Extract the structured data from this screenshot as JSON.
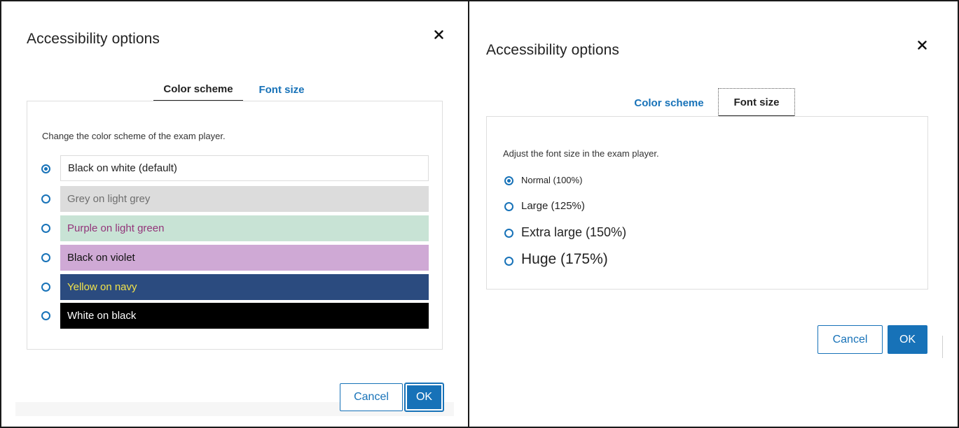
{
  "left_dialog": {
    "title": "Accessibility options",
    "tabs": [
      {
        "label": "Color scheme",
        "active": true
      },
      {
        "label": "Font size",
        "active": false
      }
    ],
    "description": "Change the color scheme of the exam player.",
    "options": [
      {
        "label": "Black on white (default)",
        "selected": true,
        "bg": "#ffffff",
        "fg": "#111111"
      },
      {
        "label": "Grey on light grey",
        "selected": false,
        "bg": "#dcdcdc",
        "fg": "#6e6e6e"
      },
      {
        "label": "Purple on light green",
        "selected": false,
        "bg": "#c8e3d5",
        "fg": "#93357a"
      },
      {
        "label": "Black on violet",
        "selected": false,
        "bg": "#cfa9d5",
        "fg": "#111111"
      },
      {
        "label": "Yellow on navy",
        "selected": false,
        "bg": "#2b4b7f",
        "fg": "#f2e34a"
      },
      {
        "label": "White on black",
        "selected": false,
        "bg": "#000000",
        "fg": "#ffffff"
      }
    ],
    "cancel_label": "Cancel",
    "ok_label": "OK"
  },
  "right_dialog": {
    "title": "Accessibility options",
    "tabs": [
      {
        "label": "Color scheme",
        "active": false
      },
      {
        "label": "Font size",
        "active": true
      }
    ],
    "description": "Adjust the font size in the exam player.",
    "options": [
      {
        "label": "Normal (100%)",
        "selected": true
      },
      {
        "label": "Large (125%)",
        "selected": false
      },
      {
        "label": "Extra large (150%)",
        "selected": false
      },
      {
        "label": "Huge (175%)",
        "selected": false
      }
    ],
    "cancel_label": "Cancel",
    "ok_label": "OK"
  },
  "colors": {
    "accent": "#1772b8",
    "panel_border": "#1a1a1a",
    "box_border": "#dedede",
    "text": "#222222"
  },
  "icons": {
    "close": "close-icon",
    "radio_checked": "radio-checked-icon",
    "radio_unchecked": "radio-unchecked-icon"
  }
}
